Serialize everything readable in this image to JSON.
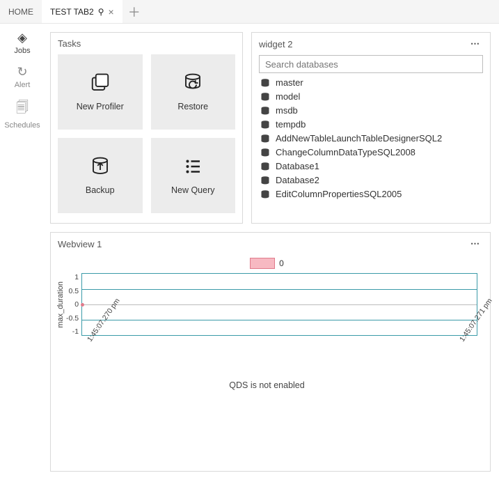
{
  "tabs": {
    "home": "HOME",
    "tab2": "TEST TAB2"
  },
  "rail": {
    "jobs": "Jobs",
    "alert": "Alert",
    "schedules": "Schedules"
  },
  "tasks": {
    "title": "Tasks",
    "new_profiler": "New Profiler",
    "restore": "Restore",
    "backup": "Backup",
    "new_query": "New Query"
  },
  "widget2": {
    "title": "widget 2",
    "search_placeholder": "Search databases",
    "items": [
      "master",
      "model",
      "msdb",
      "tempdb",
      "AddNewTableLaunchTableDesignerSQL2",
      "ChangeColumnDataTypeSQL2008",
      "Database1",
      "Database2",
      "EditColumnPropertiesSQL2005"
    ]
  },
  "webview": {
    "title": "Webview 1",
    "legend_value": "0",
    "ylabel": "max_duration",
    "footer": "QDS is not enabled"
  },
  "chart_data": {
    "type": "line",
    "title": "",
    "xlabel": "",
    "ylabel": "max_duration",
    "ylim": [
      -1.0,
      1.0
    ],
    "yticks": [
      1.0,
      0.5,
      0,
      -0.5,
      -1.0
    ],
    "x": [
      "1:45:07.270 pm",
      "1:45:07.271 pm"
    ],
    "series": [
      {
        "name": "0",
        "values": [
          0,
          null
        ],
        "color": "#e07a8b"
      }
    ],
    "legend_position": "top",
    "grid": true
  }
}
